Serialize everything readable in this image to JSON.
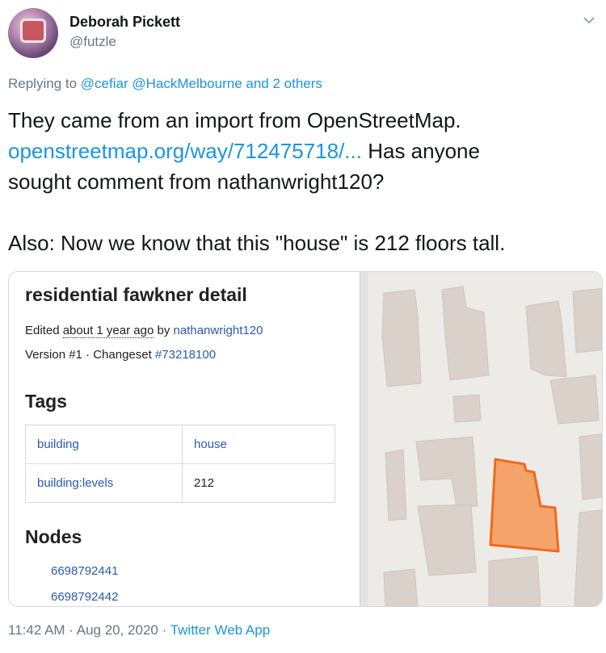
{
  "tweet": {
    "display_name": "Deborah Pickett",
    "handle": "@futzle",
    "avatar_icon": "avatar-photo",
    "menu_icon": "chevron-down-icon",
    "replying_prefix": "Replying to",
    "replying_to": "@cefiar @HackMelbourne and 2 others",
    "text_line1": "They came from an import from OpenStreetMap.",
    "url": "openstreetmap.org/way/712475718/...",
    "text_after_url": "Has anyone",
    "text_line3": "sought comment from nathanwright120?",
    "text_line4": "Also: Now we know that this \"house\" is 212 floors tall.",
    "timestamp": "11:42 AM · Aug 20, 2020 ·",
    "source_app": "Twitter Web App"
  },
  "osm": {
    "title": "residential fawkner detail",
    "edited_prefix": "Edited",
    "edited_when": "about 1 year ago",
    "edited_by_prefix": "by",
    "edited_by": "nathanwright120",
    "version": "Version #1 · Changeset",
    "changeset": "#73218100",
    "tags_heading": "Tags",
    "tags": [
      {
        "key": "building",
        "value": "house"
      },
      {
        "key": "building:levels",
        "value": "212"
      }
    ],
    "nodes_heading": "Nodes",
    "nodes": [
      "6698792441",
      "6698792442"
    ]
  },
  "colors": {
    "link": "#1b95e0",
    "osm_link": "#2a5ab0",
    "highlight_fill": "#f4a36b",
    "highlight_stroke": "#f06a1c",
    "building": "#d9d1ca",
    "map_bg": "#ecebe8"
  }
}
